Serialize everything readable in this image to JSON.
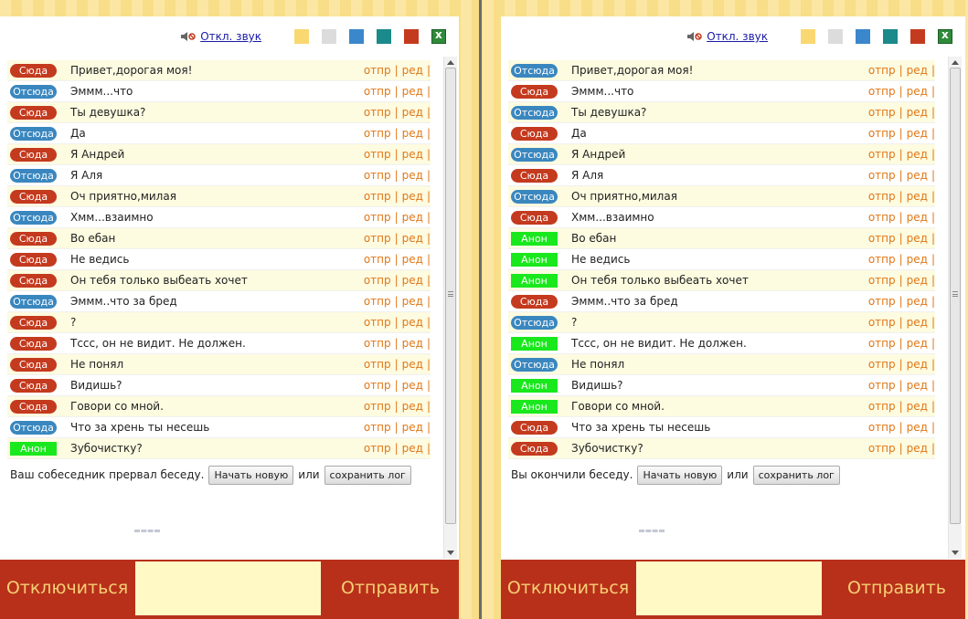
{
  "colors": {
    "syuda": "#c43a1e",
    "otsyuda": "#3a87bf",
    "anon": "#19e81d",
    "action": "#e07818",
    "bottom_bar": "#b8301a",
    "swatches": [
      "#f9d872",
      "#dcdcdc",
      "#3a87cc",
      "#1a8a8a",
      "#c43a1e"
    ]
  },
  "toolbar": {
    "sound_label": "Откл. звук",
    "icons": [
      "speaker-muted-icon",
      "excel-icon"
    ]
  },
  "actions": {
    "send": "отпр",
    "edit": "ред"
  },
  "buttons": {
    "new_chat": "Начать новую",
    "or": "или",
    "save_log": "сохранить лог"
  },
  "bottom": {
    "disconnect": "Отключиться",
    "send": "Отправить",
    "input_value": ""
  },
  "left": {
    "status": "Ваш собеседник прервал беседу.",
    "messages": [
      {
        "who": "Сюда",
        "kind": "syuda",
        "text": "Привет,дорогая моя!"
      },
      {
        "who": "Отсюда",
        "kind": "otsyuda",
        "text": "Эммм...что"
      },
      {
        "who": "Сюда",
        "kind": "syuda",
        "text": "Ты девушка?"
      },
      {
        "who": "Отсюда",
        "kind": "otsyuda",
        "text": "Да"
      },
      {
        "who": "Сюда",
        "kind": "syuda",
        "text": "Я Андрей"
      },
      {
        "who": "Отсюда",
        "kind": "otsyuda",
        "text": "Я Аля"
      },
      {
        "who": "Сюда",
        "kind": "syuda",
        "text": "Оч приятно,милая"
      },
      {
        "who": "Отсюда",
        "kind": "otsyuda",
        "text": "Хмм...взаимно"
      },
      {
        "who": "Сюда",
        "kind": "syuda",
        "text": "Во ебан"
      },
      {
        "who": "Сюда",
        "kind": "syuda",
        "text": "Не ведись"
      },
      {
        "who": "Сюда",
        "kind": "syuda",
        "text": "Он тебя только выбеать хочет"
      },
      {
        "who": "Отсюда",
        "kind": "otsyuda",
        "text": "Эммм..что за бред"
      },
      {
        "who": "Сюда",
        "kind": "syuda",
        "text": "?"
      },
      {
        "who": "Сюда",
        "kind": "syuda",
        "text": "Тссс, он не видит. Не должен."
      },
      {
        "who": "Сюда",
        "kind": "syuda",
        "text": "Не понял"
      },
      {
        "who": "Сюда",
        "kind": "syuda",
        "text": "Видишь?"
      },
      {
        "who": "Сюда",
        "kind": "syuda",
        "text": "Говори со мной."
      },
      {
        "who": "Отсюда",
        "kind": "otsyuda",
        "text": "Что за хрень ты несешь"
      },
      {
        "who": "Анон",
        "kind": "anon",
        "text": "Зубочистку?"
      }
    ]
  },
  "right": {
    "status": "Вы окончили беседу.",
    "messages": [
      {
        "who": "Отсюда",
        "kind": "otsyuda",
        "text": "Привет,дорогая моя!"
      },
      {
        "who": "Сюда",
        "kind": "syuda",
        "text": "Эммм...что"
      },
      {
        "who": "Отсюда",
        "kind": "otsyuda",
        "text": "Ты девушка?"
      },
      {
        "who": "Сюда",
        "kind": "syuda",
        "text": "Да"
      },
      {
        "who": "Отсюда",
        "kind": "otsyuda",
        "text": "Я Андрей"
      },
      {
        "who": "Сюда",
        "kind": "syuda",
        "text": "Я Аля"
      },
      {
        "who": "Отсюда",
        "kind": "otsyuda",
        "text": "Оч приятно,милая"
      },
      {
        "who": "Сюда",
        "kind": "syuda",
        "text": "Хмм...взаимно"
      },
      {
        "who": "Анон",
        "kind": "anon",
        "text": "Во ебан"
      },
      {
        "who": "Анон",
        "kind": "anon",
        "text": "Не ведись"
      },
      {
        "who": "Анон",
        "kind": "anon",
        "text": "Он тебя только выбеать хочет"
      },
      {
        "who": "Сюда",
        "kind": "syuda",
        "text": "Эммм..что за бред"
      },
      {
        "who": "Отсюда",
        "kind": "otsyuda",
        "text": "?"
      },
      {
        "who": "Анон",
        "kind": "anon",
        "text": "Тссс, он не видит. Не должен."
      },
      {
        "who": "Отсюда",
        "kind": "otsyuda",
        "text": "Не понял"
      },
      {
        "who": "Анон",
        "kind": "anon",
        "text": "Видишь?"
      },
      {
        "who": "Анон",
        "kind": "anon",
        "text": "Говори со мной."
      },
      {
        "who": "Сюда",
        "kind": "syuda",
        "text": "Что за хрень ты несешь"
      },
      {
        "who": "Сюда",
        "kind": "syuda",
        "text": "Зубочистку?"
      }
    ]
  }
}
